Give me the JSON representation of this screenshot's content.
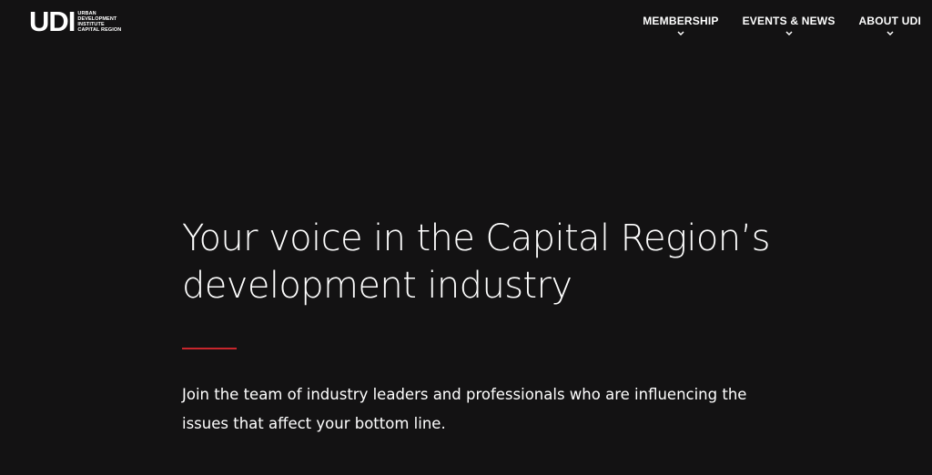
{
  "header": {
    "logo": {
      "mark": "UDI",
      "lines": [
        "URBAN",
        "DEVELOPMENT",
        "INSTITUTE",
        "CAPITAL REGION"
      ]
    },
    "nav": [
      {
        "label": "MEMBERSHIP",
        "icon": "chevron-down-icon"
      },
      {
        "label": "EVENTS & NEWS",
        "icon": "chevron-down-icon"
      },
      {
        "label": "ABOUT UDI",
        "icon": "chevron-down-icon"
      }
    ]
  },
  "hero": {
    "title_line1": "Your voice in the Capital Region’s",
    "title_line2": "development industry",
    "body": "Join the team of industry leaders and professionals who are influencing the issues that affect your bottom line."
  },
  "colors": {
    "background": "#131213",
    "accent": "#c8262d",
    "text": "#ffffff"
  }
}
